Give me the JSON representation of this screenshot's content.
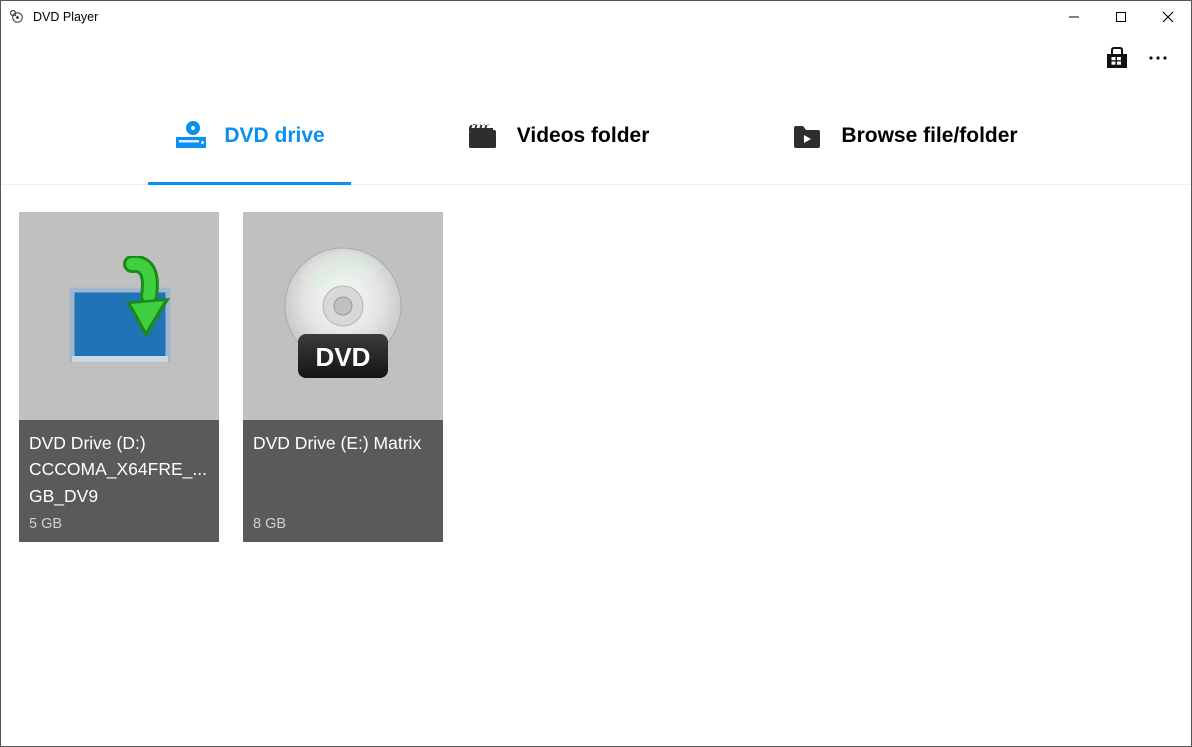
{
  "window": {
    "title": "DVD Player"
  },
  "tabs": {
    "dvd_drive": "DVD drive",
    "videos_folder": "Videos folder",
    "browse": "Browse file/folder"
  },
  "drives": [
    {
      "name": "DVD Drive (D:) CCCOMA_X64FRE_... GB_DV9",
      "size": "5 GB",
      "kind": "install"
    },
    {
      "name": "DVD Drive (E:) Matrix",
      "size": "8 GB",
      "kind": "dvd"
    }
  ]
}
